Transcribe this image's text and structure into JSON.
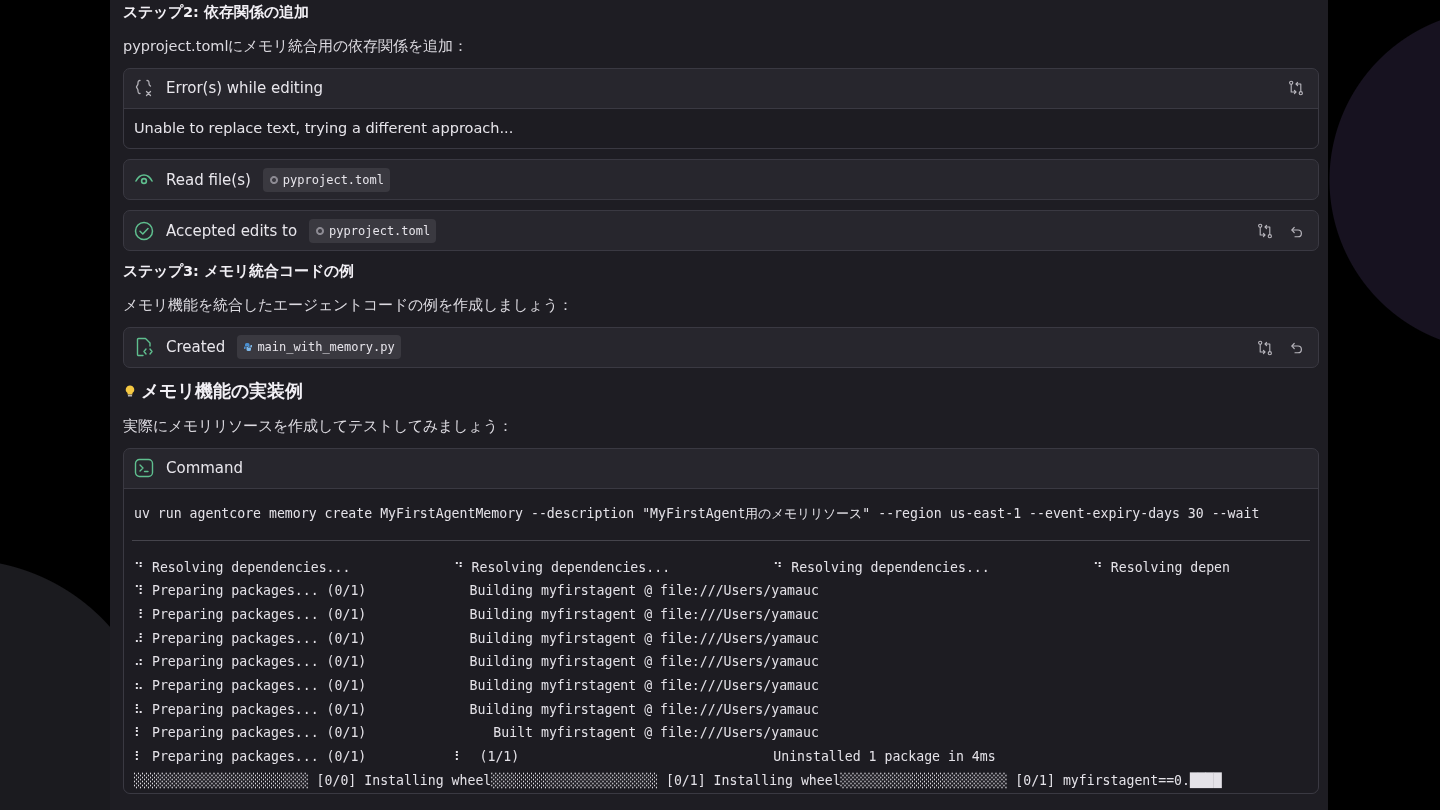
{
  "blocks": [
    {
      "kind": "heading",
      "text": "ステップ2: 依存関係の追加"
    },
    {
      "kind": "paragraph",
      "text": "pyproject.tomlにメモリ統合用の依存関係を追加："
    },
    {
      "kind": "error_card",
      "title": "Error(s) while editing",
      "body": "Unable to replace text, trying a different approach...",
      "actions": [
        {
          "kind": "diff"
        }
      ]
    },
    {
      "kind": "read_card",
      "title": "Read file(s)",
      "file": {
        "name": "pyproject.toml",
        "kind": "config"
      }
    },
    {
      "kind": "accepted_card",
      "title": "Accepted edits to",
      "file": {
        "name": "pyproject.toml",
        "kind": "config"
      },
      "actions": [
        {
          "kind": "diff"
        },
        {
          "kind": "undo"
        }
      ]
    },
    {
      "kind": "heading",
      "text": "ステップ3: メモリ統合コードの例"
    },
    {
      "kind": "paragraph",
      "text": "メモリ機能を統合したエージェントコードの例を作成しましょう："
    },
    {
      "kind": "created_card",
      "title": "Created",
      "file": {
        "name": "main_with_memory.py",
        "kind": "python"
      },
      "actions": [
        {
          "kind": "diff"
        },
        {
          "kind": "undo"
        }
      ]
    },
    {
      "kind": "idea_heading",
      "text": "メモリ機能の実装例"
    },
    {
      "kind": "paragraph",
      "text": "実際にメモリリソースを作成してテストしてみましょう："
    },
    {
      "kind": "command_card",
      "title": "Command",
      "command": "uv run agentcore memory create MyFirstAgentMemory --description \"MyFirstAgent用のメモリリソース\" --region us-east-1 --event-expiry-days 30 --wait",
      "output": [
        "⠙ Resolving dependencies...             ⠙ Resolving dependencies...             ⠙ Resolving dependencies...             ⠙ Resolving depen",
        "⠹ Preparing packages... (0/1)             Building myfirstagent @ file:///Users/yamauc",
        "⠸ Preparing packages... (0/1)             Building myfirstagent @ file:///Users/yamauc",
        "⠼ Preparing packages... (0/1)             Building myfirstagent @ file:///Users/yamauc",
        "⠴ Preparing packages... (0/1)             Building myfirstagent @ file:///Users/yamauc",
        "⠦ Preparing packages... (0/1)             Building myfirstagent @ file:///Users/yamauc",
        "⠧ Preparing packages... (0/1)             Building myfirstagent @ file:///Users/yamauc",
        "⠇ Preparing packages... (0/1)                Built myfirstagent @ file:///Users/yamauc",
        "⠇ Preparing packages... (0/1)           ⠇  (1/1)                                Uninstalled 1 package in 4ms",
        "░░░░░░░░░░░░░░░░░░░░░░ [0/0] Installing wheel░░░░░░░░░░░░░░░░░░░░░ [0/1] Installing wheel░░░░░░░░░░░░░░░░░░░░░ [0/1] myfirstagent==0.████"
      ]
    }
  ]
}
